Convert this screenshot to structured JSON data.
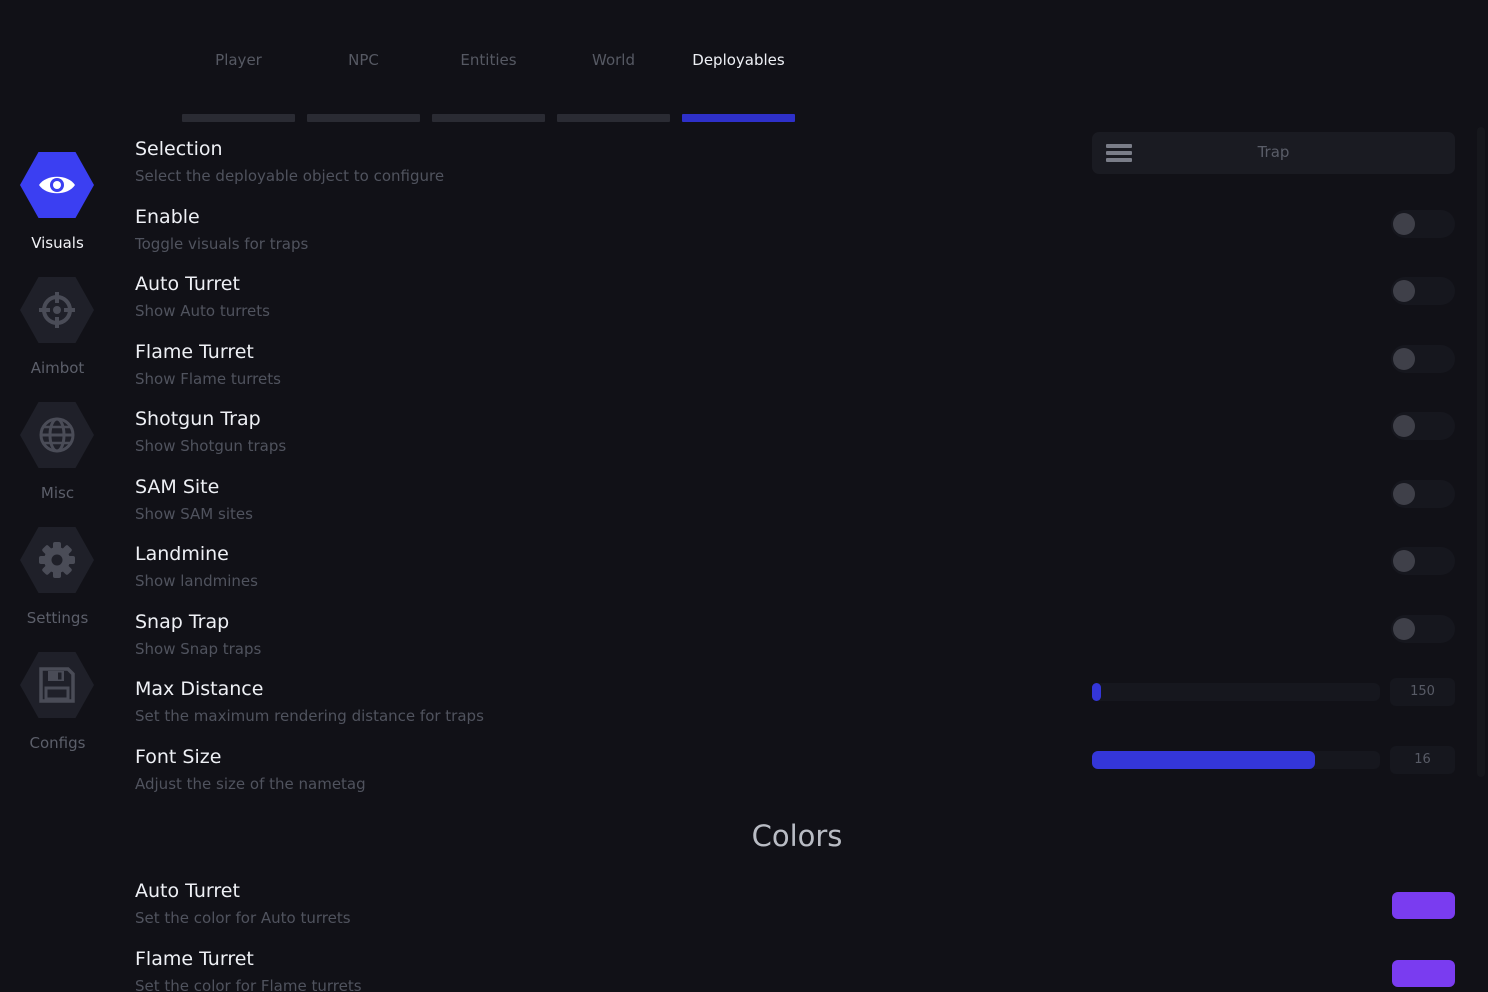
{
  "sidebar": {
    "items": [
      {
        "label": "Visuals",
        "icon": "eye-icon",
        "active": true
      },
      {
        "label": "Aimbot",
        "icon": "crosshair-icon",
        "active": false
      },
      {
        "label": "Misc",
        "icon": "globe-icon",
        "active": false
      },
      {
        "label": "Settings",
        "icon": "gear-icon",
        "active": false
      },
      {
        "label": "Configs",
        "icon": "save-icon",
        "active": false
      }
    ]
  },
  "tabs": [
    {
      "label": "Player",
      "active": false
    },
    {
      "label": "NPC",
      "active": false
    },
    {
      "label": "Entities",
      "active": false
    },
    {
      "label": "World",
      "active": false
    },
    {
      "label": "Deployables",
      "active": true
    }
  ],
  "settings": {
    "selection": {
      "title": "Selection",
      "description": "Select the deployable object to configure",
      "value": "Trap",
      "icon": "menu-icon"
    },
    "enable": {
      "title": "Enable",
      "description": "Toggle visuals for traps",
      "on": false
    },
    "auto_turret": {
      "title": "Auto Turret",
      "description": "Show Auto turrets",
      "on": false
    },
    "flame_turret": {
      "title": "Flame Turret",
      "description": "Show Flame turrets",
      "on": false
    },
    "shotgun_trap": {
      "title": "Shotgun Trap",
      "description": "Show Shotgun traps",
      "on": false
    },
    "sam_site": {
      "title": "SAM Site",
      "description": "Show SAM sites",
      "on": false
    },
    "landmine": {
      "title": "Landmine",
      "description": "Show landmines",
      "on": false
    },
    "snap_trap": {
      "title": "Snap Trap",
      "description": "Show Snap traps",
      "on": false
    },
    "max_distance": {
      "title": "Max Distance",
      "description": "Set the maximum rendering distance for traps",
      "value": "150",
      "fill_fraction": 0.03
    },
    "font_size": {
      "title": "Font Size",
      "description": "Adjust the size of the nametag",
      "value": "16",
      "fill_fraction": 0.775
    }
  },
  "colors_section": {
    "heading": "Colors",
    "items": [
      {
        "title": "Auto Turret",
        "description": "Set the color for Auto turrets",
        "color": "#7a3cf0"
      },
      {
        "title": "Flame Turret",
        "description": "Set the color for Flame turrets",
        "color": "#7a3cf0"
      }
    ]
  },
  "theme": {
    "accent": "#3436d8",
    "background": "#111117"
  }
}
